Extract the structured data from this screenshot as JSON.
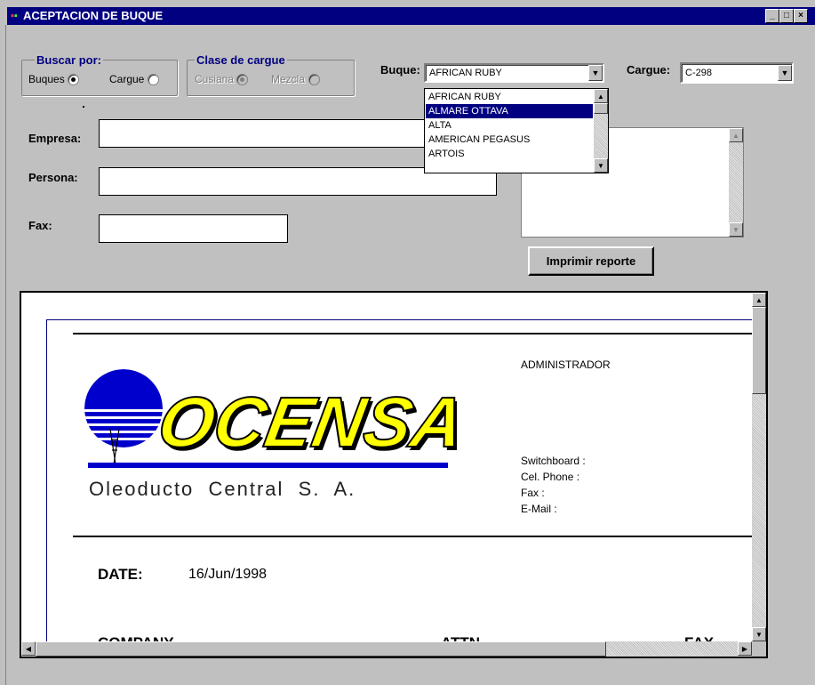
{
  "window": {
    "title": "ACEPTACION DE BUQUE",
    "controls": [
      "_",
      "□",
      "×"
    ]
  },
  "buscar_por": {
    "legend": "Buscar por:",
    "options": [
      {
        "label": "Buques",
        "selected": true
      },
      {
        "label": "Cargue",
        "selected": false
      }
    ]
  },
  "clase_cargue": {
    "legend": "Clase de cargue",
    "options": [
      {
        "label": "Cusiana",
        "selected": true
      },
      {
        "label": "Mezcla",
        "selected": false
      }
    ]
  },
  "buque": {
    "label": "Buque:",
    "value": "AFRICAN RUBY",
    "list": [
      "AFRICAN RUBY",
      "ALMARE OTTAVA",
      "ALTA",
      "AMERICAN PEGASUS",
      "ARTOIS"
    ],
    "selected_index": 1
  },
  "cargue": {
    "label": "Cargue:",
    "value": "C-298"
  },
  "form": {
    "empresa_label": "Empresa:",
    "persona_label": "Persona:",
    "fax_label": "Fax:",
    "empresa_value": "",
    "persona_value": "",
    "fax_value": ""
  },
  "print_button": "Imprimir reporte",
  "report": {
    "logo_text": "OCENSA",
    "company_name": "Oleoducto  Central  S.  A.",
    "admin": "ADMINISTRADOR",
    "switchboard": "Switchboard :",
    "cel_phone": "Cel. Phone :",
    "fax": "Fax :",
    "email": "E-Mail :",
    "date_label": "DATE:",
    "date_value": "16/Jun/1998",
    "company_label": "COMPANY",
    "attn_label": "ATTN",
    "fax_label": "FAX"
  },
  "colors": {
    "title_bar": "#000080",
    "logo_blue": "#0000cc",
    "logo_yellow": "#ffff00"
  }
}
